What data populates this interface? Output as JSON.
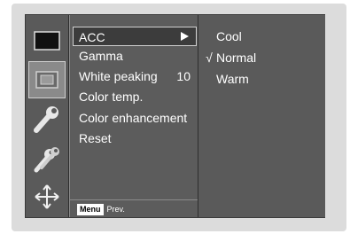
{
  "menu": {
    "items": [
      {
        "label": "ACC",
        "value": "",
        "has_submenu": true,
        "highlighted": true
      },
      {
        "label": "Gamma",
        "value": ""
      },
      {
        "label": "White peaking",
        "value": "10"
      },
      {
        "label": "Color temp.",
        "value": ""
      },
      {
        "label": "Color enhancement",
        "value": ""
      },
      {
        "label": "Reset",
        "value": ""
      }
    ]
  },
  "submenu": {
    "items": [
      {
        "label": "Cool",
        "check": ""
      },
      {
        "label": "Normal",
        "check": "√"
      },
      {
        "label": "Warm",
        "check": ""
      }
    ]
  },
  "footer": {
    "menu_key": "Menu",
    "prev_label": "Prev."
  },
  "icons": [
    "screen-icon",
    "picture-icon",
    "wrench-icon",
    "wrenches-icon",
    "move-arrows-icon"
  ],
  "colors": {
    "panel": "#505050",
    "highlight_border": "#d0d0d0",
    "text": "#ffffff"
  }
}
